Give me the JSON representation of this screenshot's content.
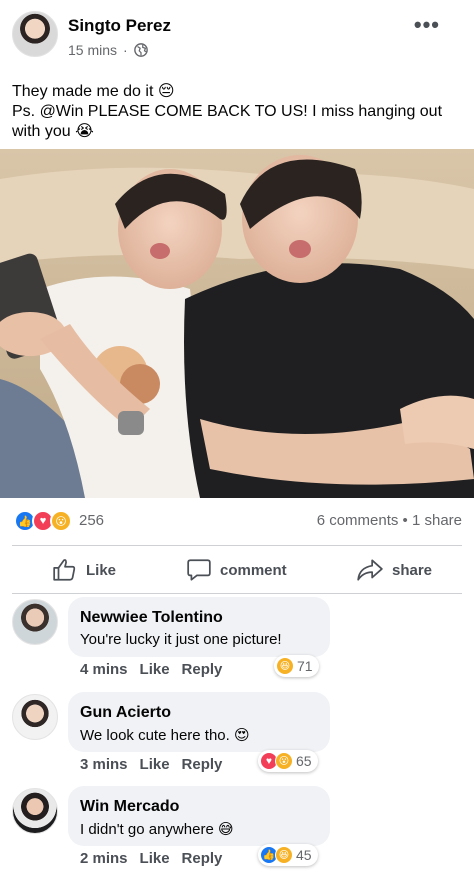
{
  "post": {
    "author": "Singto Perez",
    "time": "15 mins",
    "separator": "·",
    "privacy_icon": "globe-icon",
    "more_icon": "more-options-icon",
    "more_label": "•••",
    "text_line1": "They made me do it 😔",
    "text_line2": "Ps. @Win PLEASE COME BACK TO US! I miss hanging out with you 😭"
  },
  "reactions": {
    "count": "256",
    "summary": "6 comments • 1 share",
    "icons": [
      "like-icon",
      "love-icon",
      "wow-icon"
    ]
  },
  "actions": {
    "like": "Like",
    "comment": "comment",
    "share": "share"
  },
  "comments": [
    {
      "name": "Newwiee Tolentino",
      "text": "You're lucky it just one picture!",
      "time": "4 mins",
      "like": "Like",
      "reply": "Reply",
      "react_icons": [
        "haha-icon"
      ],
      "react_count": "71"
    },
    {
      "name": "Gun Acierto",
      "text": "We look cute here tho. 😍",
      "time": "3 mins",
      "like": "Like",
      "reply": "Reply",
      "react_icons": [
        "love-icon",
        "wow-icon"
      ],
      "react_count": "65"
    },
    {
      "name": "Win Mercado",
      "text": "I didn't go anywhere 😅",
      "time": "2 mins",
      "like": "Like",
      "reply": "Reply",
      "react_icons": [
        "like-icon",
        "haha-icon"
      ],
      "react_count": "45"
    }
  ],
  "colors": {
    "like": "#1877f2",
    "love": "#f33e58",
    "wow": "#f7b125",
    "muted": "#65676b"
  }
}
